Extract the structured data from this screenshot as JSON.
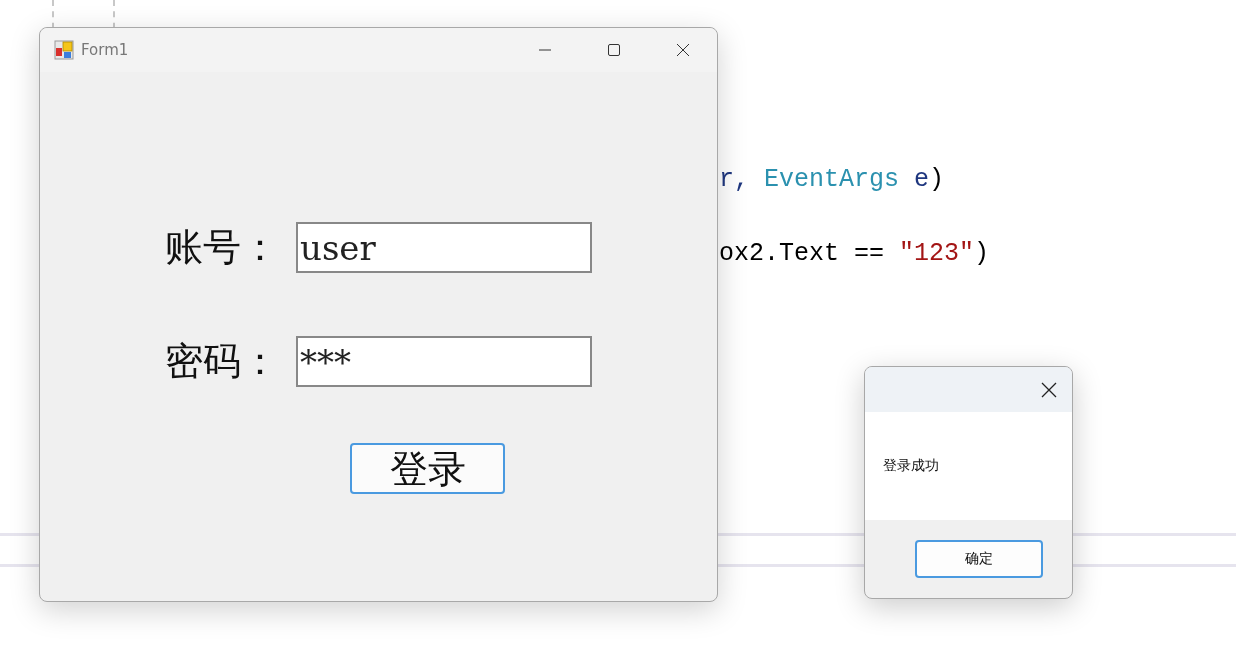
{
  "code_editor": {
    "lines": [
      {
        "tokens": [
          {
            "text": "r, ",
            "color": "#1f377f"
          },
          {
            "text": "EventArgs",
            "color": "#2b91af"
          },
          {
            "text": " e",
            "color": "#1f377f"
          },
          {
            "text": ")",
            "color": "#000000"
          }
        ]
      },
      {
        "tokens": [
          {
            "text": "ox2.Text == ",
            "color": "#000000"
          },
          {
            "text": "\"123\"",
            "color": "#a31515"
          },
          {
            "text": ")",
            "color": "#000000"
          }
        ]
      }
    ]
  },
  "form_window": {
    "title": "Form1",
    "fields": [
      {
        "label": "账号：",
        "value": "user"
      },
      {
        "label": "密码：",
        "value": "***"
      }
    ],
    "button": "登录"
  },
  "message_box": {
    "message": "登录成功",
    "button": "确定"
  }
}
